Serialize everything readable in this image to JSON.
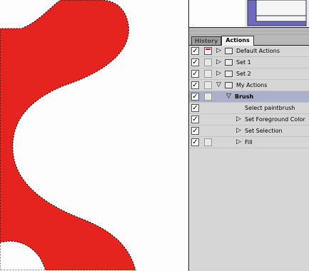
{
  "panel": {
    "tabs": [
      {
        "label": "History"
      },
      {
        "label": "Actions"
      }
    ],
    "rows": [
      {
        "label": "Default Actions",
        "checked": "✓"
      },
      {
        "label": "Set 1",
        "checked": "✓"
      },
      {
        "label": "Set 2",
        "checked": "✓"
      },
      {
        "label": "My Actions",
        "checked": "✓"
      },
      {
        "label": "Brush",
        "checked": "✓"
      },
      {
        "label": "Select paintbrush",
        "checked": "✓"
      },
      {
        "label": "Set Foreground Color",
        "checked": "✓"
      },
      {
        "label": "Set Selection",
        "checked": "✓"
      },
      {
        "label": "Fill",
        "checked": "✓"
      }
    ]
  },
  "canvas": {
    "shape_color": "#e52420",
    "background": "#fdfdfd"
  }
}
